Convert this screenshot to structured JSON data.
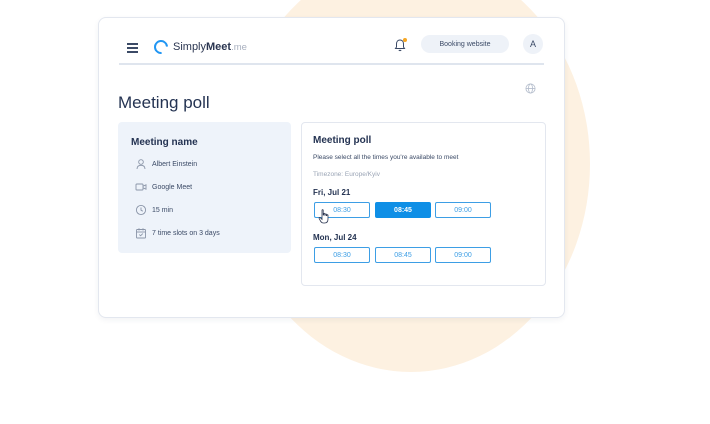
{
  "brand": {
    "name_light": "Simply",
    "name_bold": "Meet",
    "tld": ".me",
    "color": "#2196f3"
  },
  "header": {
    "booking_label": "Booking website",
    "avatar_initial": "A"
  },
  "page": {
    "title": "Meeting poll"
  },
  "meeting": {
    "heading": "Meeting name",
    "details": [
      {
        "icon": "person-icon",
        "text": "Albert Einstein"
      },
      {
        "icon": "video-icon",
        "text": "Google Meet"
      },
      {
        "icon": "clock-icon",
        "text": "15 min"
      },
      {
        "icon": "calendar-icon",
        "text": "7 time slots on 3 days"
      }
    ]
  },
  "poll": {
    "title": "Meeting poll",
    "instruction": "Please select all the times you're available to meet",
    "timezone": "Timezone: Europe/Kyiv",
    "days": [
      {
        "label": "Fri, Jul 21",
        "slots": [
          "08:30",
          "08:45",
          "09:00"
        ],
        "selected": "08:45"
      },
      {
        "label": "Mon, Jul 24",
        "slots": [
          "08:30",
          "08:45",
          "09:00"
        ]
      }
    ]
  },
  "colors": {
    "accent": "#0f8fe6",
    "slot_border": "#3d9ee5",
    "background_circle": "#fdf1e1",
    "bell_dot": "#f6a623"
  }
}
